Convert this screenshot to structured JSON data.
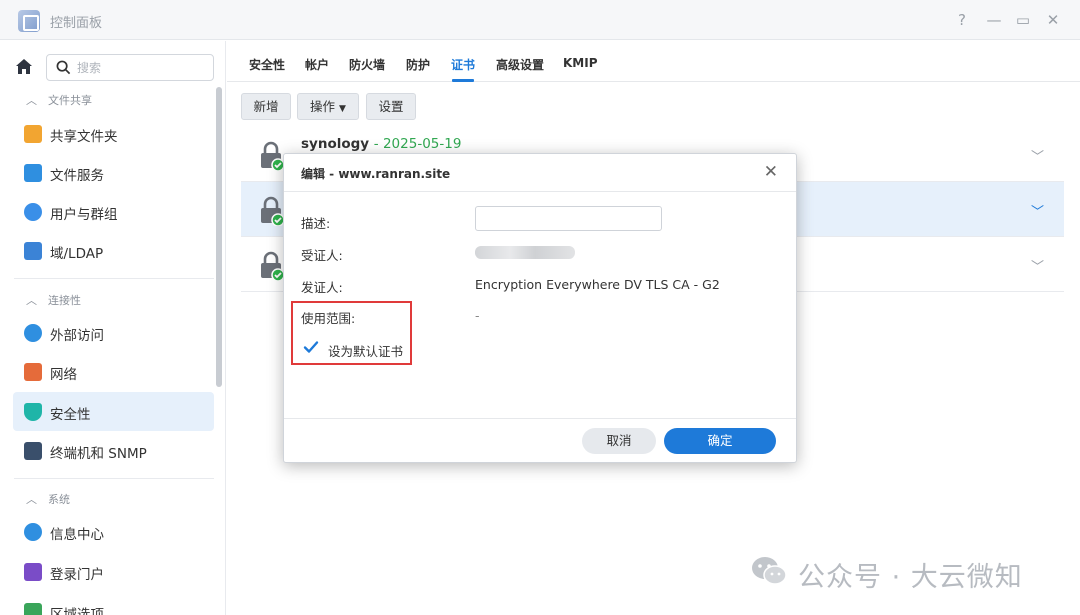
{
  "window": {
    "title": "控制面板",
    "controls": [
      "?",
      "—",
      "▭",
      "✕"
    ]
  },
  "sidebar": {
    "search_placeholder": "搜索",
    "sections": [
      {
        "label": "文件共享"
      },
      {
        "label": "连接性"
      },
      {
        "label": "系统"
      }
    ],
    "items": [
      {
        "label": "共享文件夹",
        "icon": "shared-folder-icon",
        "color": "#f2a531"
      },
      {
        "label": "文件服务",
        "icon": "file-services-icon",
        "color": "#2f8fe0"
      },
      {
        "label": "用户与群组",
        "icon": "users-icon",
        "color": "#3a8fe8"
      },
      {
        "label": "域/LDAP",
        "icon": "domain-ldap-icon",
        "color": "#3b83d6"
      },
      {
        "label": "外部访问",
        "icon": "external-access-icon",
        "color": "#2f8fe0"
      },
      {
        "label": "网络",
        "icon": "network-icon",
        "color": "#e56b3a"
      },
      {
        "label": "安全性",
        "icon": "security-shield-icon",
        "color": "#1fb5a8"
      },
      {
        "label": "终端机和 SNMP",
        "icon": "terminal-icon",
        "color": "#3a4f6b"
      },
      {
        "label": "信息中心",
        "icon": "info-center-icon",
        "color": "#2f8fe0"
      },
      {
        "label": "登录门户",
        "icon": "login-portal-icon",
        "color": "#7a4cc7"
      },
      {
        "label": "区域选项",
        "icon": "regional-options-icon",
        "color": "#3aa55a"
      }
    ]
  },
  "tabs": [
    {
      "label": "安全性"
    },
    {
      "label": "帐户"
    },
    {
      "label": "防火墙"
    },
    {
      "label": "防护"
    },
    {
      "label": "证书"
    },
    {
      "label": "高级设置"
    },
    {
      "label": "KMIP"
    }
  ],
  "active_tab": "证书",
  "toolbar": {
    "add_label": "新增",
    "action_label": "操作",
    "settings_label": "设置"
  },
  "certificates": [
    {
      "name": "synology",
      "date": "2025-05-19"
    }
  ],
  "dialog": {
    "title": "编辑 - www.ranran.site",
    "description_label": "描述:",
    "description_value": "",
    "subject_label": "受证人:",
    "issuer_label": "发证人:",
    "issuer_value": "Encryption Everywhere DV TLS CA - G2",
    "usage_label": "使用范围:",
    "usage_value": "-",
    "default_cert_label": "设为默认证书",
    "default_cert_checked": true,
    "cancel_label": "取消",
    "ok_label": "确定"
  },
  "watermark": {
    "text": "公众号 · 大云微知"
  },
  "colors": {
    "accent": "#1e7ad9",
    "selected_row": "#e6f0fb",
    "highlight_border": "#e03a3a",
    "date_green": "#32a852"
  }
}
